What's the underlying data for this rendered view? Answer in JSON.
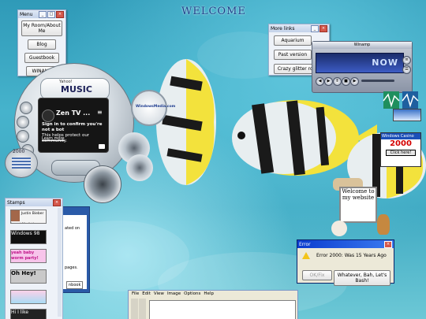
{
  "desktop": {
    "title": "WELCOME"
  },
  "menu_window": {
    "title": "Menu",
    "buttons": [
      "My Room/About Me",
      "Blog",
      "Guestbook",
      "WINAMP"
    ]
  },
  "links_window": {
    "title": "More links",
    "buttons": [
      "Aquarium",
      "Past version",
      "Crazy glitter room"
    ]
  },
  "media_player": {
    "title": "Winamp",
    "display_text": "NOW"
  },
  "musicmatch": {
    "brand_small": "Yahoo!",
    "brand_large": "MUSIC",
    "windowsmedia_label": "WindowsMedia.com"
  },
  "zen_tv": {
    "title": "Zen TV ...",
    "subtitle": "Sign in to confirm you're not a bot",
    "body": "This helps protect our community.",
    "link": "Learn more"
  },
  "error_dialog": {
    "title": "Error",
    "message": "Error 2000: Was 15 Years Ago",
    "button_disabled": "OK/Fix",
    "button_primary": "Whatever, Bah, Let's Bash!"
  },
  "stamps_window": {
    "title": "Stamps",
    "items": [
      "Justin Bieber is not My father",
      "Windows 98",
      "yeah baby worm party!",
      "Oh Hey!",
      "",
      "Hi I like"
    ]
  },
  "partial_window": {
    "texts": [
      "ated on",
      "pages.",
      "nbook"
    ]
  },
  "paint": {
    "menu": [
      "File",
      "Edit",
      "View",
      "Image",
      "Options",
      "Help"
    ]
  },
  "welcome_sign": {
    "text": "Welcome to my website"
  },
  "windows_casino": {
    "title": "Windows Casino",
    "headline": "2000",
    "cta": "Click here!"
  },
  "icons": {
    "year_badge": "2000"
  }
}
